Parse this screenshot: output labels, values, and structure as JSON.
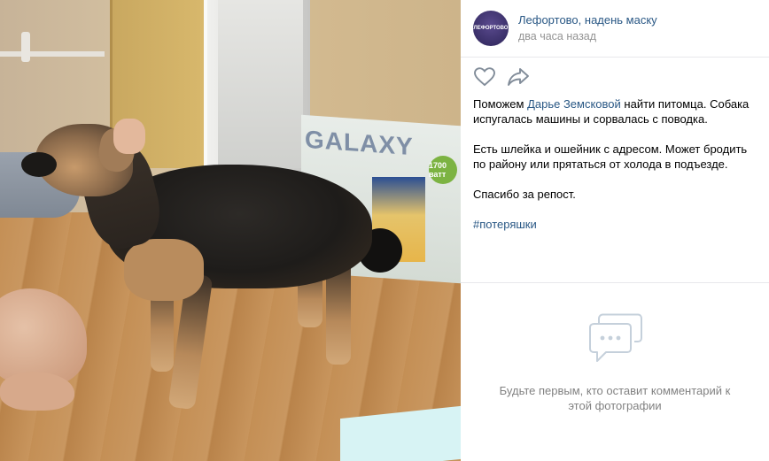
{
  "post": {
    "group_name": "Лефортово, надень маску",
    "time": "два часа назад",
    "avatar_label": "ЛЕФОРТОВО",
    "text_prefix": "Поможем ",
    "mention": "Дарье Земсковой",
    "text_suffix": " найти питомца. Собака испугалась машины и сорвалась с поводка.",
    "paragraph2": "Есть шлейка и ошейник с адресом. Может бродить по району или прятаться от холода в подъезде.",
    "paragraph3": "Спасибо за репост.",
    "hashtag": "#потеряшки"
  },
  "actions": [
    {
      "name": "like",
      "icon": "heart-icon"
    },
    {
      "name": "share",
      "icon": "share-arrow-icon"
    }
  ],
  "comments": {
    "empty_text": "Будьте первым, кто оставит комментарий к этой фотографии",
    "icon": "comments-bubble-icon"
  },
  "photo": {
    "box_brand": "GALAXY",
    "badge": "1700 ватт"
  },
  "colors": {
    "link": "#2a5885",
    "muted": "#939393",
    "divider": "#e7e8ec"
  }
}
